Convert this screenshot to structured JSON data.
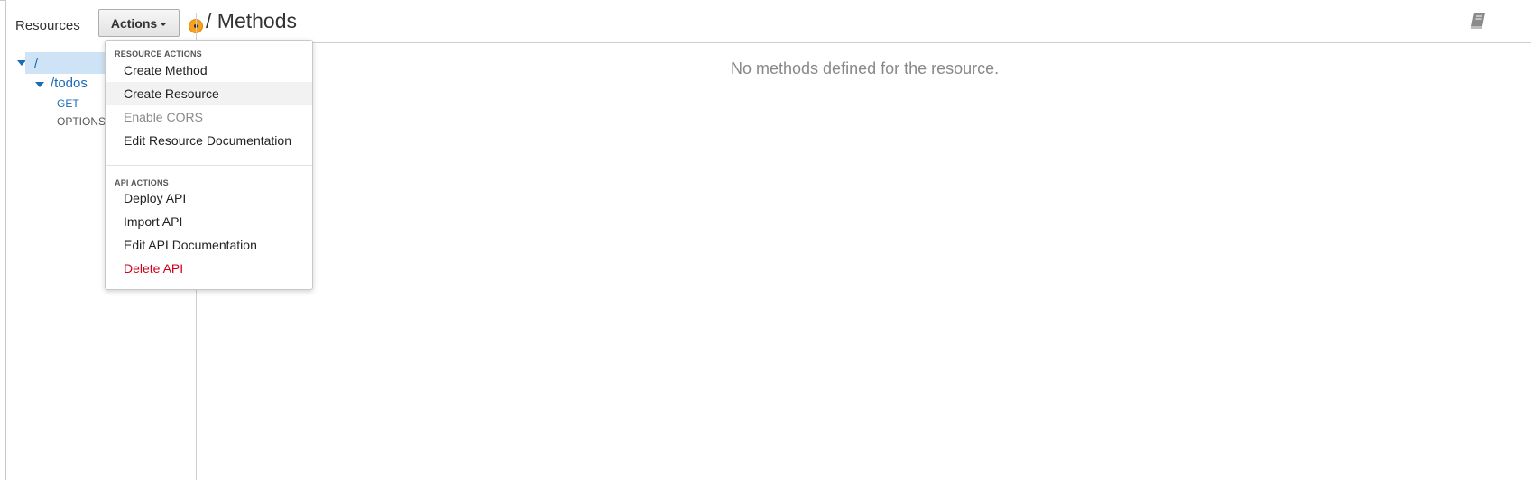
{
  "sidebar": {
    "title": "Resources",
    "tree": {
      "root": "/",
      "child": "/todos",
      "methods": [
        "GET",
        "OPTIONS"
      ]
    }
  },
  "toolbar": {
    "actions_label": "Actions"
  },
  "main": {
    "title": "/ Methods",
    "empty_message": "No methods defined for the resource."
  },
  "dropdown": {
    "resource_header": "RESOURCE ACTIONS",
    "resource_items": [
      "Create Method",
      "Create Resource",
      "Enable CORS",
      "Edit Resource Documentation"
    ],
    "api_header": "API ACTIONS",
    "api_items": [
      "Deploy API",
      "Import API",
      "Edit API Documentation",
      "Delete API"
    ]
  },
  "icons": {
    "book": "book-icon",
    "caret": "caret-down-icon",
    "tree_expand": "triangle-down-icon",
    "status_dot": "orange-dot-icon"
  },
  "colors": {
    "link_blue": "#1a6bb8",
    "selection_bg": "#cfe3f6",
    "danger_red": "#d0021b",
    "orange_indicator": "#f79f1f"
  }
}
